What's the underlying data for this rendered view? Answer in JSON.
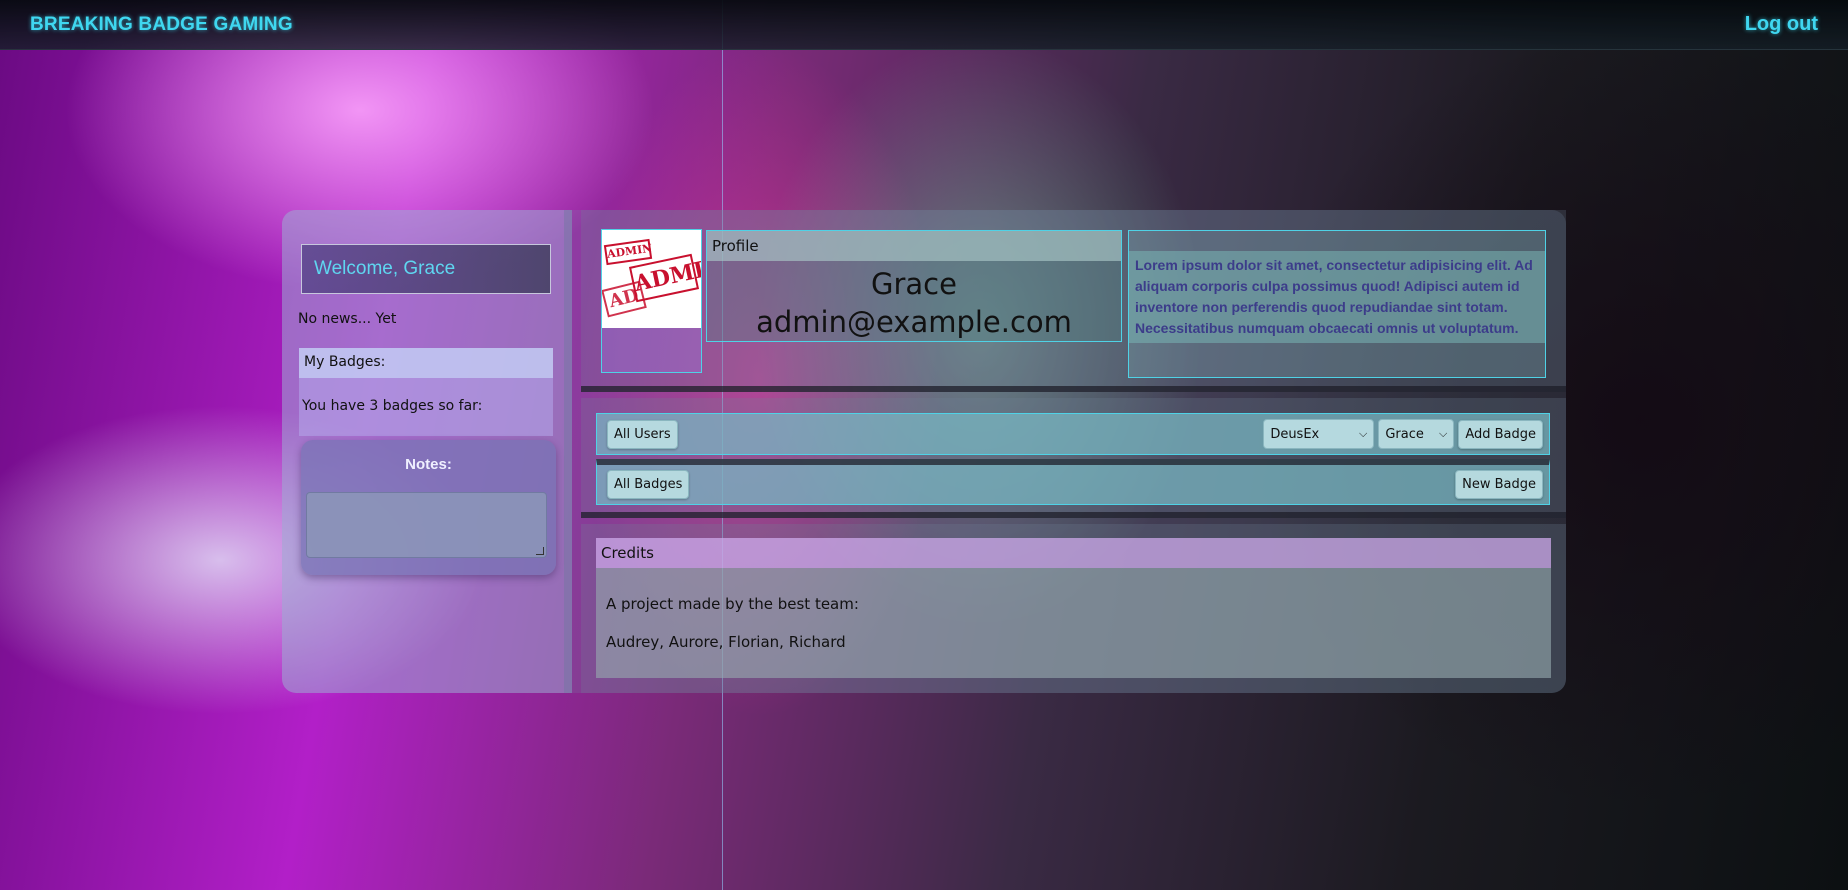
{
  "navbar": {
    "brand": "BREAKING BADGE GAMING",
    "logout_label": "Log out"
  },
  "sidebar": {
    "welcome": "Welcome, Grace",
    "news": "No news... Yet",
    "badges_title": "My Badges:",
    "badges_count_text": "You have 3 badges so far:",
    "notes_title": "Notes:",
    "notes_value": ""
  },
  "profile": {
    "avatar_stamp_small": "ADMIN",
    "avatar_stamp_large": "ADMIN",
    "avatar_stamp_partial": "AD",
    "header": "Profile",
    "name": "Grace",
    "email": "admin@example.com",
    "bio": "Lorem ipsum dolor sit amet, consectetur adipisicing elit. Ad aliquam corporis culpa possimus quod! Adipisci autem id inventore non perferendis quod repudiandae sint totam. Necessitatibus numquam obcaecati omnis ut voluptatum."
  },
  "actions": {
    "all_users_label": "All Users",
    "game_select_value": "DeusEx",
    "user_select_value": "Grace",
    "add_badge_label": "Add Badge",
    "all_badges_label": "All Badges",
    "new_badge_label": "New Badge"
  },
  "credits": {
    "header": "Credits",
    "line1": "A project made by the best team:",
    "line2": "Audrey, Aurore, Florian, Richard"
  },
  "colors": {
    "accent_cyan": "#3fd7f0",
    "border_cyan": "#4fd2e6",
    "stamp_red": "#c8102e"
  },
  "icons": {
    "select_chevron": "chevron-down-icon",
    "notes_resize": "resize-handle-icon"
  }
}
